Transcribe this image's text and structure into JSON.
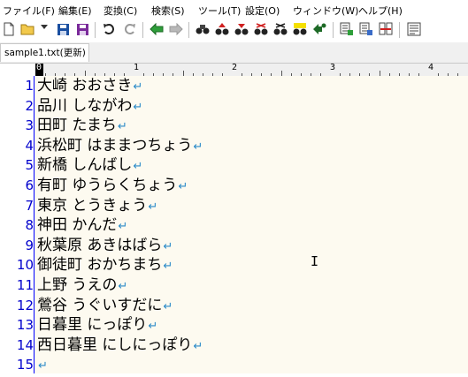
{
  "menu": [
    "ファイル(F)",
    "編集(E)",
    "変換(C)",
    "検索(S)",
    "ツール(T)",
    "設定(O)",
    "ウィンドウ(W)",
    "ヘルプ(H)"
  ],
  "tab": {
    "label": "sample1.txt(更新)"
  },
  "ruler": {
    "labels": [
      "0",
      "1",
      "2",
      "3",
      "4"
    ]
  },
  "editor": {
    "eol_symbol": "↵",
    "lines": [
      {
        "num": "1",
        "text": "大崎 おおさき"
      },
      {
        "num": "2",
        "text": "品川 しながわ"
      },
      {
        "num": "3",
        "text": "田町 たまち"
      },
      {
        "num": "4",
        "text": "浜松町 はままつちょう"
      },
      {
        "num": "5",
        "text": "新橋 しんばし"
      },
      {
        "num": "6",
        "text": "有町 ゆうらくちょう"
      },
      {
        "num": "7",
        "text": "東京 とうきょう"
      },
      {
        "num": "8",
        "text": "神田 かんだ"
      },
      {
        "num": "9",
        "text": "秋葉原 あきはばら"
      },
      {
        "num": "10",
        "text": "御徒町 おかちまち"
      },
      {
        "num": "11",
        "text": "上野 うえの"
      },
      {
        "num": "12",
        "text": "鶯谷 うぐいすだに"
      },
      {
        "num": "13",
        "text": "日暮里 にっぽり"
      },
      {
        "num": "14",
        "text": "西日暮里 にしにっぽり"
      },
      {
        "num": "15",
        "text": ""
      }
    ]
  },
  "cursor": {
    "glyph": "I"
  },
  "colors": {
    "line_number": "#0000cc",
    "eol": "#2a8ac8",
    "editor_bg": "#fdfaf0"
  }
}
